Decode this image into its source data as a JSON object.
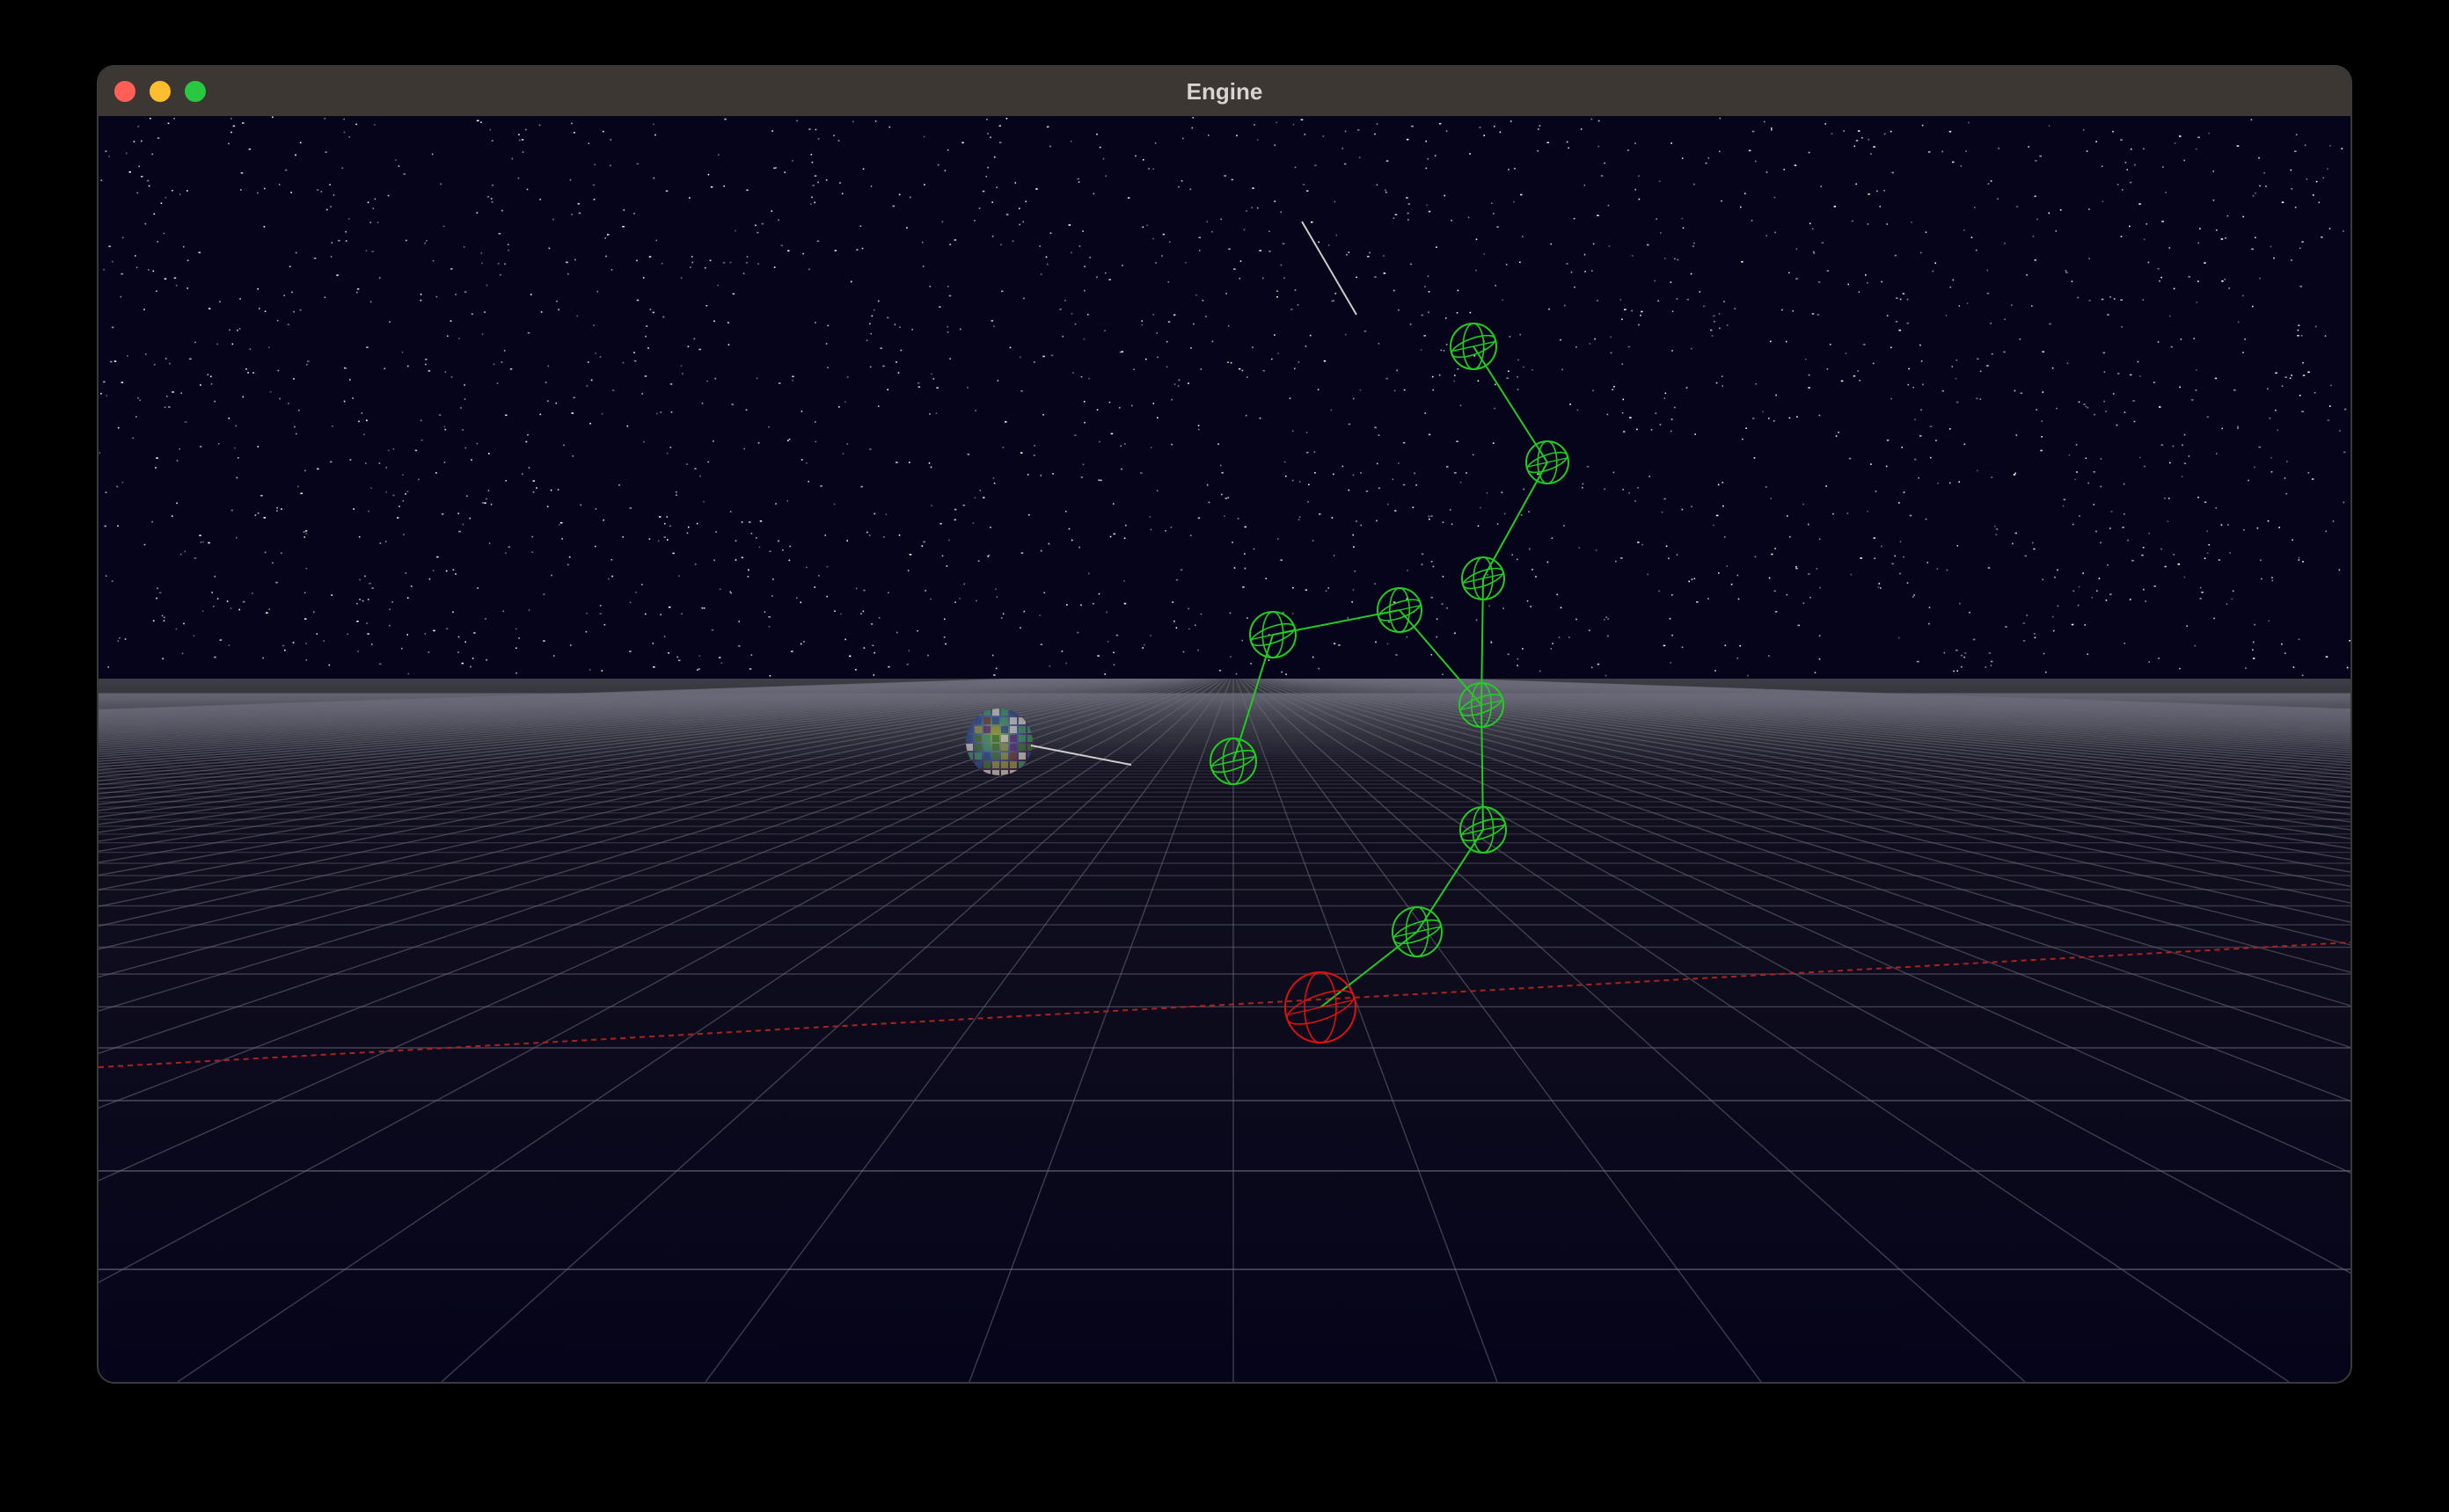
{
  "window": {
    "title": "Engine",
    "controls": [
      "close",
      "minimize",
      "zoom"
    ]
  },
  "scene": {
    "type": "3d-viewport",
    "sky": "starfield",
    "ground": "perspective-grid",
    "colors": {
      "sky": "#05041a",
      "grid": "#6a6a78",
      "joint_active": "#22cc22",
      "joint_end": "#dd1111",
      "axis": "#aa2222",
      "guide_line": "#cccccc"
    },
    "objects": {
      "ik_chain_joint_count": 9,
      "target": "textured-sphere"
    }
  }
}
